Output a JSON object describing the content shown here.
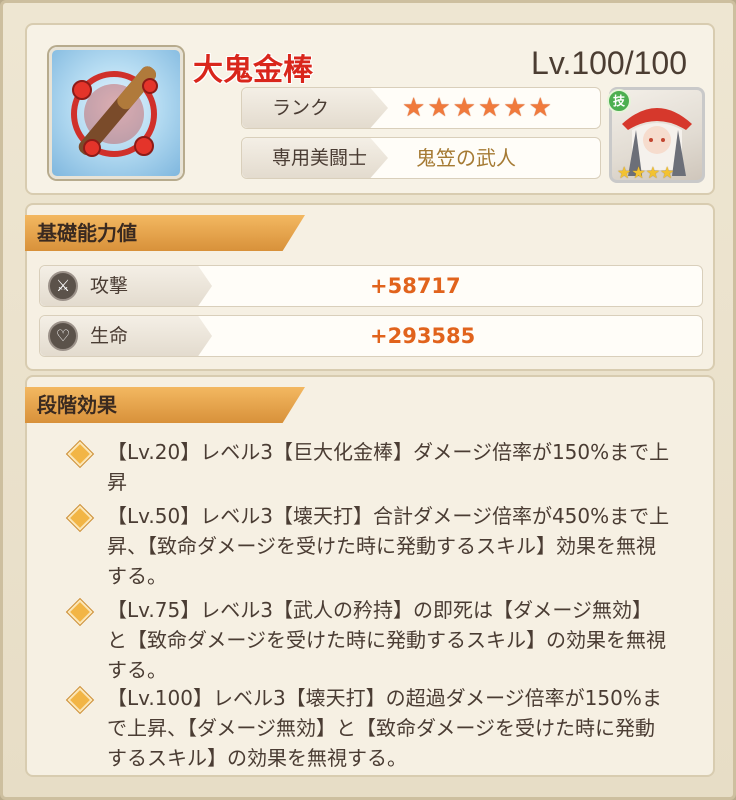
{
  "item": {
    "name": "大鬼金棒",
    "level": "Lv.100/100"
  },
  "rank": {
    "label": "ランク",
    "stars": 6
  },
  "exclusive": {
    "label": "専用美闘士",
    "unit_name": "鬼笠の武人"
  },
  "portrait": {
    "badge": "技",
    "stars": "★★★★"
  },
  "basic_stats": {
    "header": "基礎能力値",
    "attack": {
      "label": "攻撃",
      "value": "+58717"
    },
    "life": {
      "label": "生命",
      "value": "+293585"
    }
  },
  "stage_effects": {
    "header": "段階効果",
    "items": [
      "【Lv.20】レベル3【巨大化金棒】ダメージ倍率が150%まで上昇",
      "【Lv.50】レベル3【壊天打】合計ダメージ倍率が450%まで上昇、【致命ダメージを受けた時に発動するスキル】効果を無視する。",
      "【Lv.75】レベル3【武人の矜持】の即死は【ダメージ無効】と【致命ダメージを受けた時に発動するスキル】の効果を無視する。",
      "【Lv.100】レベル3【壊天打】の超過ダメージ倍率が150%まで上昇、【ダメージ無効】と【致命ダメージを受けた時に発動するスキル】の効果を無視する。"
    ]
  },
  "colors": {
    "title_red": "#d9261c",
    "value_orange": "#e1631c",
    "star_orange": "#f07a3c",
    "header_gold": "#d8913a"
  }
}
